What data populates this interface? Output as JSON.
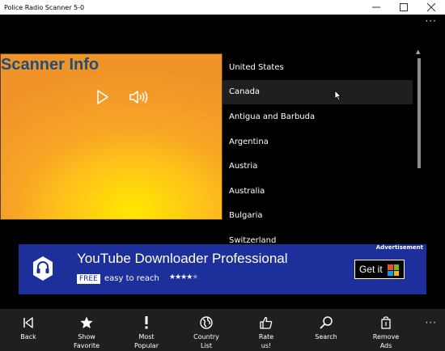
{
  "window": {
    "title": "Police Radio Scanner 5-0",
    "controls": [
      "minimize-icon",
      "maximize-icon",
      "close-icon"
    ]
  },
  "appbar": {
    "more_label": "···"
  },
  "scanner": {
    "heading": "Scanner Info",
    "icons": [
      "play-icon",
      "volume-icon"
    ]
  },
  "countries": {
    "items": [
      "United States",
      "Canada",
      "Antigua and Barbuda",
      "Argentina",
      "Austria",
      "Australia",
      "Bulgaria",
      "Switzerland"
    ],
    "hovered": "Canada"
  },
  "ad": {
    "label": "Advertisement",
    "title": "YouTube Downloader Professional",
    "free_badge": "FREE",
    "tagline": "easy to reach",
    "stars": "★★★★",
    "half_star": "★",
    "cta": "Get it",
    "colors": {
      "background": "#1d2f9b",
      "win_red": "#f25022",
      "win_green": "#7fba00",
      "win_blue": "#00a4ef",
      "win_yellow": "#ffb900"
    }
  },
  "commands": [
    {
      "icon": "back-icon",
      "label": "Back"
    },
    {
      "icon": "star-icon",
      "label": "Show\nFavorite"
    },
    {
      "icon": "exclamation-icon",
      "label": "Most\nPopular"
    },
    {
      "icon": "globe-icon",
      "label": "Country\nList"
    },
    {
      "icon": "thumbs-up-icon",
      "label": "Rate\nus!"
    },
    {
      "icon": "search-icon",
      "label": "Search"
    },
    {
      "icon": "remove-ads-icon",
      "label": "Remove\nAds"
    }
  ],
  "cmd_more_label": "···"
}
